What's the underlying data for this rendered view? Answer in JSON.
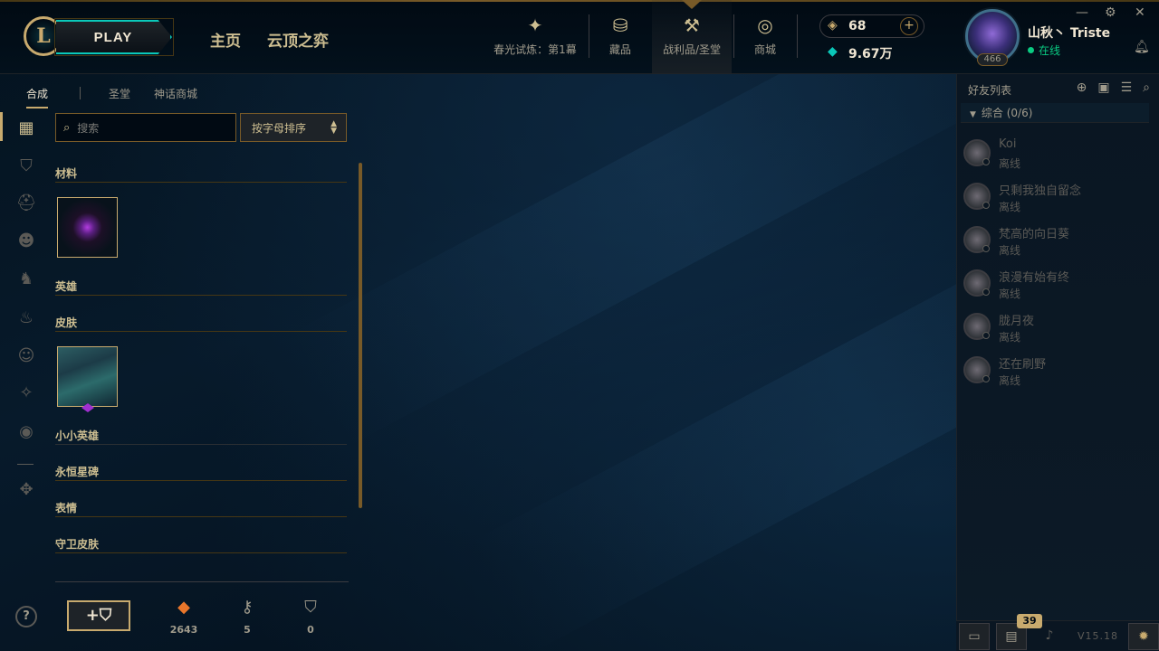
{
  "header": {
    "play_label": "PLAY",
    "nav": [
      {
        "label": "主页"
      },
      {
        "label": "云顶之弈"
      }
    ],
    "icon_tabs": [
      {
        "label": "春光试炼：第1幕",
        "icon": "event-icon"
      },
      {
        "label": "藏品",
        "icon": "collection-icon"
      },
      {
        "label": "战利品/圣堂",
        "icon": "loot-icon"
      },
      {
        "label": "商城",
        "icon": "store-icon"
      }
    ],
    "currency": {
      "blue_essence": "68",
      "riot_points": "9.67万"
    },
    "profile": {
      "name": "山秋丶 Triste",
      "status": "在线",
      "level": "466"
    }
  },
  "subtabs": [
    {
      "label": "合成"
    },
    {
      "label": "圣堂"
    },
    {
      "label": "神话商城"
    }
  ],
  "search": {
    "placeholder": "搜索"
  },
  "sort": {
    "label": "按字母排序"
  },
  "sections": [
    {
      "title": "材料"
    },
    {
      "title": "英雄"
    },
    {
      "title": "皮肤"
    },
    {
      "title": "小小英雄"
    },
    {
      "title": "永恒星碑"
    },
    {
      "title": "表情"
    },
    {
      "title": "守卫皮肤"
    }
  ],
  "counters": [
    {
      "value": "2643",
      "icon": "orange-essence-icon"
    },
    {
      "value": "5",
      "icon": "key-icon"
    },
    {
      "value": "0",
      "icon": "chest-icon"
    }
  ],
  "social": {
    "title": "好友列表",
    "group": "综合 (0/6)",
    "friends": [
      {
        "name": "Koi",
        "status": "离线"
      },
      {
        "name": "只剩我独自留念",
        "status": "离线"
      },
      {
        "name": "梵高的向日葵",
        "status": "离线"
      },
      {
        "name": "浪漫有始有终",
        "status": "离线"
      },
      {
        "name": "胧月夜",
        "status": "离线"
      },
      {
        "name": "还在刷野",
        "status": "离线"
      }
    ],
    "notifications": "39",
    "version": "V15.18"
  },
  "colors": {
    "gold": "#c8aa6e",
    "teal": "#0ac8b9",
    "online": "#0acb82",
    "bg": "#010a13"
  }
}
